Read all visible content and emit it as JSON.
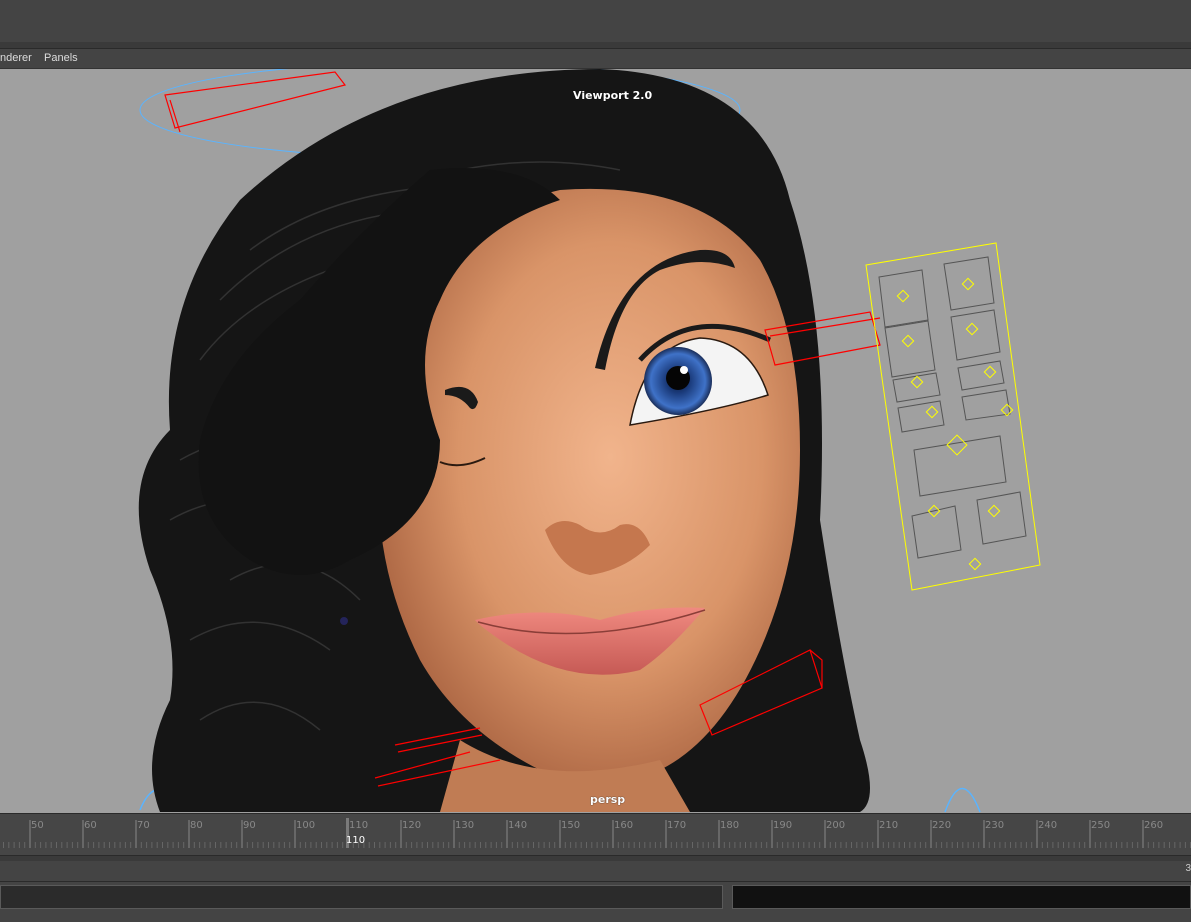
{
  "menu": {
    "renderer": "nderer",
    "panels": "Panels"
  },
  "viewport": {
    "renderer_label": "Viewport 2.0",
    "camera_label": "persp"
  },
  "timeline": {
    "ticks": [
      "50",
      "60",
      "70",
      "80",
      "90",
      "100",
      "110",
      "120",
      "130",
      "140",
      "150",
      "160",
      "170",
      "180",
      "190",
      "200",
      "210",
      "220",
      "230",
      "240",
      "250",
      "260"
    ],
    "current_frame": "110"
  },
  "range": {
    "end_digit": "3"
  },
  "colors": {
    "viewport_bg": "#a0a0a0",
    "selected_controls": "#ff0000",
    "face_panel": "#ffff00",
    "curves": "#5ab4ff"
  }
}
